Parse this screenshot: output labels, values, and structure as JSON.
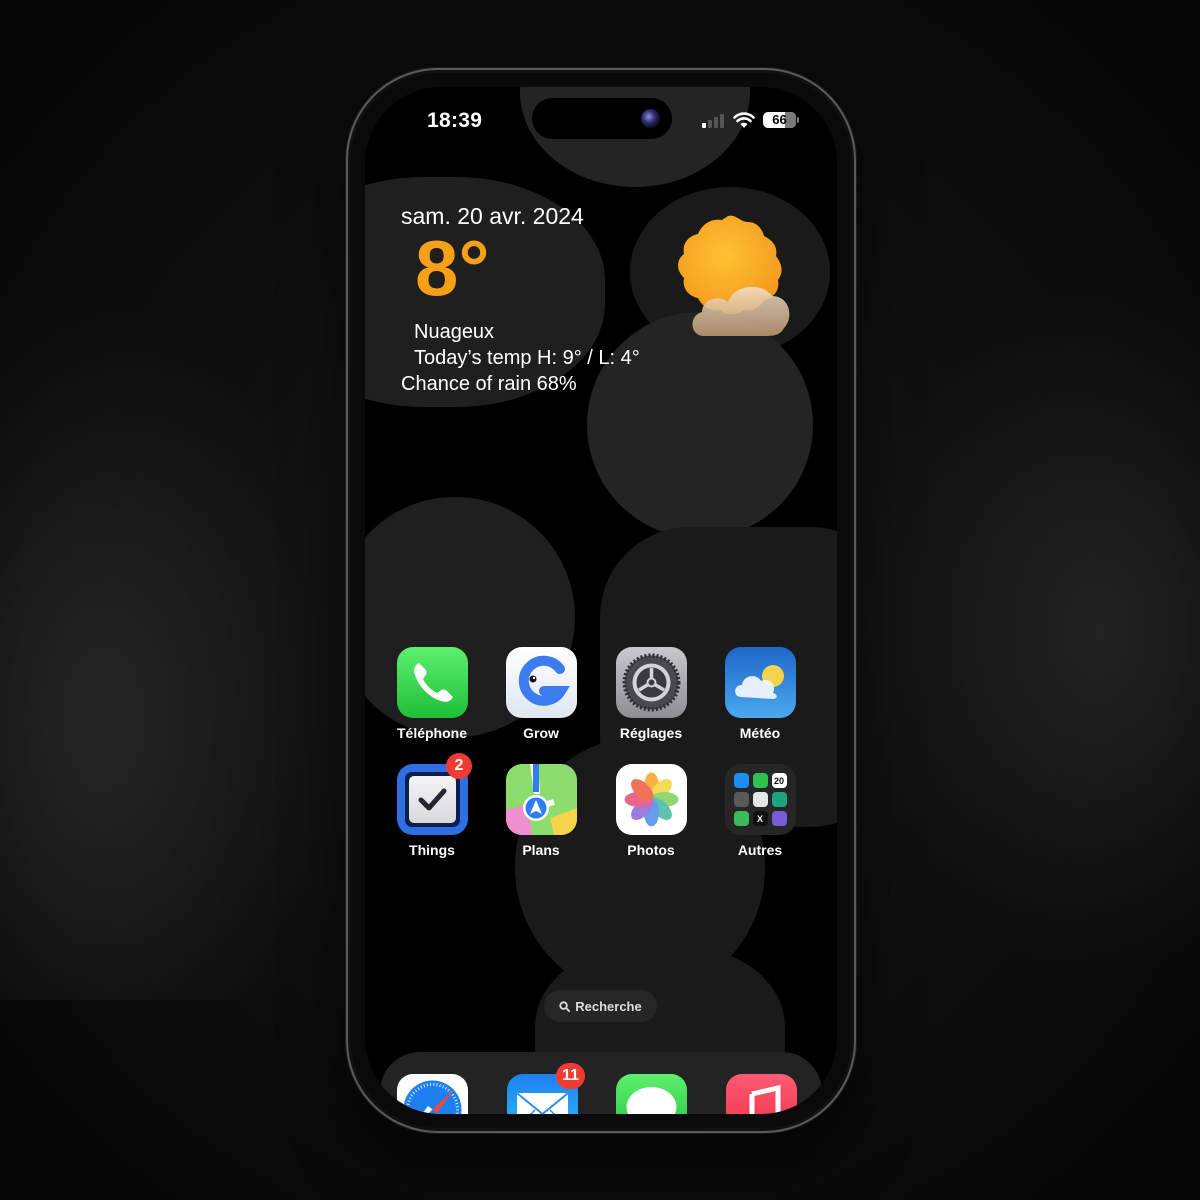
{
  "status_bar": {
    "time": "18:39",
    "signal_bars": 1,
    "signal_total": 4,
    "wifi": "wifi-icon",
    "battery_percent": "66"
  },
  "weather_widget": {
    "date": "sam. 20 avr. 2024",
    "temperature": "8°",
    "condition": "Nuageux",
    "high_low": "Today’s temp H: 9° / L: 4°",
    "rain_chance": "Chance of rain 68%",
    "icon": "sun-behind-cloud-icon",
    "accent_color": "#f6a01a"
  },
  "home_apps": [
    {
      "label": "Téléphone",
      "icon": "phone-icon"
    },
    {
      "label": "Grow",
      "icon": "grow-icon"
    },
    {
      "label": "Réglages",
      "icon": "settings-gear-icon"
    },
    {
      "label": "Météo",
      "icon": "weather-icon"
    },
    {
      "label": "Things",
      "icon": "things-checkbox-icon",
      "badge": "2"
    },
    {
      "label": "Plans",
      "icon": "maps-icon"
    },
    {
      "label": "Photos",
      "icon": "photos-icon"
    },
    {
      "label": "Autres",
      "icon": "folder-icon",
      "folder_apps": [
        "App Store",
        "FaceTime",
        "Calendrier",
        "Appareil photo",
        "Horloge",
        "Things widget",
        "Localiser",
        "X",
        "Butterfly"
      ],
      "calendar_day": "20"
    }
  ],
  "search": {
    "label": "Recherche",
    "icon": "search-icon"
  },
  "dock": [
    {
      "name": "Safari",
      "icon": "safari-compass-icon"
    },
    {
      "name": "Mail",
      "icon": "mail-envelope-icon",
      "badge": "11"
    },
    {
      "name": "Messages",
      "icon": "messages-bubble-icon"
    },
    {
      "name": "Musique",
      "icon": "music-note-icon"
    }
  ]
}
